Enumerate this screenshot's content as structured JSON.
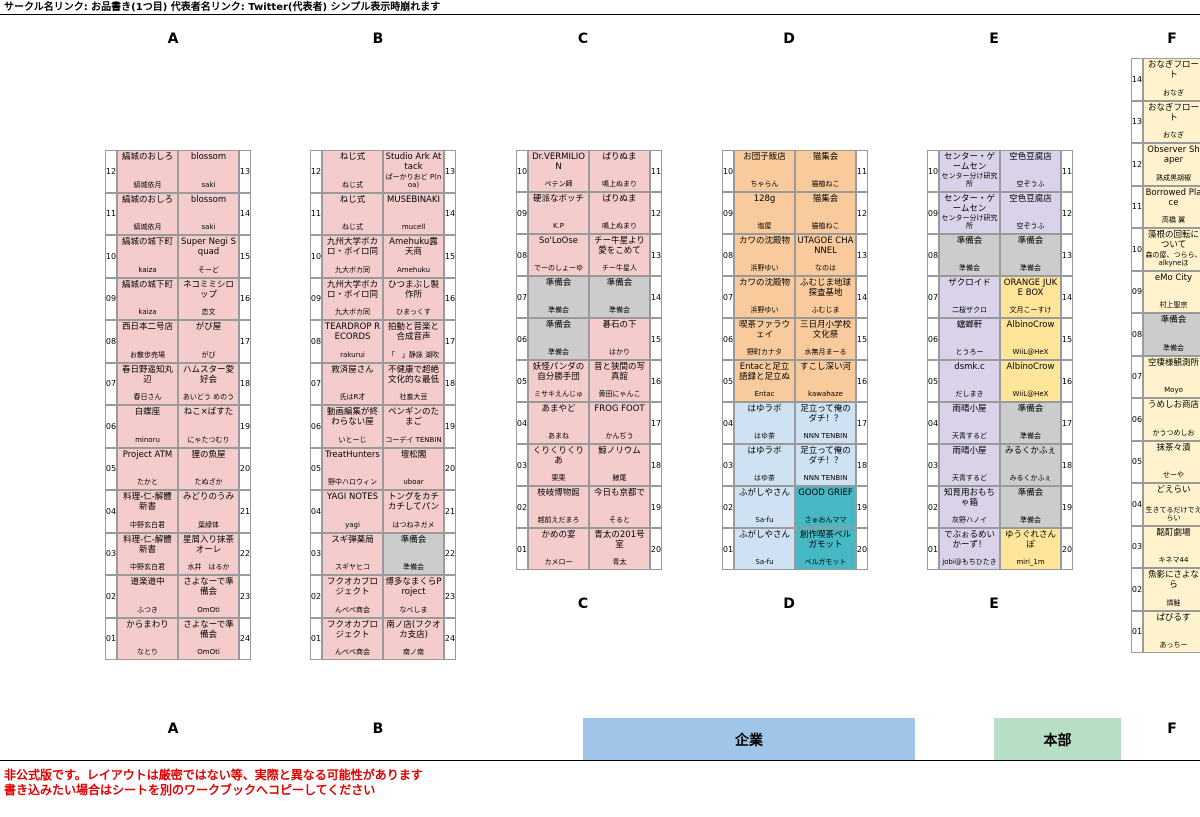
{
  "header": {
    "title": "サークル名リンク: お品書き(1つ目) 代表者名リンク: Twitter(代表者) シンプル表示時崩れます"
  },
  "columns_top": [
    "A",
    "B",
    "C",
    "D",
    "E",
    "F"
  ],
  "columns_bottom": [
    "A",
    "B",
    "C",
    "D",
    "E",
    "F"
  ],
  "zones": {
    "company": "企業",
    "hq": "本部"
  },
  "disclaimer": {
    "line1": "非公式版です。レイアウトは厳密ではない等、実際と異なる可能性があります",
    "line2": "書き込みたい場合はシートを別のワークブックへコピーしてください"
  },
  "colors": {
    "pink": "#f4cccc",
    "gray": "#cccccc",
    "orange": "#f9cb9c",
    "blue": "#cfe2f3",
    "teal": "#45b8c4",
    "purple": "#d9d2e9",
    "yellow": "#ffe599",
    "cream": "#fff2cc",
    "company": "#9fc5e8",
    "hq": "#b6dfc6"
  },
  "blocks": [
    {
      "id": "A",
      "left": [
        {
          "num": "12",
          "name": "縞城のおしろ",
          "rep": "縞城依月",
          "color": "pink"
        },
        {
          "num": "11",
          "name": "縞城のおしろ",
          "rep": "縞城依月",
          "color": "pink"
        },
        {
          "num": "10",
          "name": "縞城の城下町",
          "rep": "kaiza",
          "color": "pink"
        },
        {
          "num": "09",
          "name": "縞城の城下町",
          "rep": "kaiza",
          "color": "pink"
        },
        {
          "num": "08",
          "name": "西日本二号店",
          "rep": "お散歩売場",
          "color": "pink"
        },
        {
          "num": "07",
          "name": "春日野遥知丸辺",
          "rep": "春日さん",
          "color": "pink"
        },
        {
          "num": "06",
          "name": "白蝶座",
          "rep": "minoru",
          "color": "pink"
        },
        {
          "num": "05",
          "name": "Project ATM",
          "rep": "たかと",
          "color": "pink"
        },
        {
          "num": "04",
          "name": "料理-仁-解體新書",
          "rep": "中野玄白君",
          "color": "pink"
        },
        {
          "num": "03",
          "name": "料理-仁-解體新書",
          "rep": "中野玄白君",
          "color": "pink"
        },
        {
          "num": "02",
          "name": "道楽道中",
          "rep": "ふつき",
          "color": "pink"
        },
        {
          "num": "01",
          "name": "からまわり",
          "rep": "なとり",
          "color": "pink"
        }
      ],
      "right": [
        {
          "num": "13",
          "name": "blossom",
          "rep": "saki",
          "color": "pink"
        },
        {
          "num": "14",
          "name": "blossom",
          "rep": "saki",
          "color": "pink"
        },
        {
          "num": "15",
          "name": "Super Negi Squad",
          "rep": "そーど",
          "color": "pink"
        },
        {
          "num": "16",
          "name": "ネコミミシロップ",
          "rep": "恋文",
          "color": "pink"
        },
        {
          "num": "17",
          "name": "がび屋",
          "rep": "がび",
          "color": "pink"
        },
        {
          "num": "18",
          "name": "ハムスター愛好会",
          "rep": "あいどう めのう",
          "color": "pink"
        },
        {
          "num": "19",
          "name": "ねこ×ばすた",
          "rep": "にゃたつむり",
          "color": "pink"
        },
        {
          "num": "20",
          "name": "狸の魚屋",
          "rep": "たぬざか",
          "color": "pink"
        },
        {
          "num": "21",
          "name": "みどりのうみ",
          "rep": "葉緑体",
          "color": "pink"
        },
        {
          "num": "22",
          "name": "星屑入り抹茶オーレ",
          "rep": "水井　はるか",
          "color": "pink"
        },
        {
          "num": "23",
          "name": "さよなーで準備会",
          "rep": "OmOti",
          "color": "pink"
        },
        {
          "num": "24",
          "name": "さよなーで準備会",
          "rep": "OmOti",
          "color": "pink"
        }
      ]
    },
    {
      "id": "B",
      "left": [
        {
          "num": "12",
          "name": "ねじ式",
          "rep": "ねじ式",
          "color": "pink"
        },
        {
          "num": "11",
          "name": "ねじ式",
          "rep": "ねじ式",
          "color": "pink"
        },
        {
          "num": "10",
          "name": "九州大学ボカロ・ボイロ同",
          "rep": "九大ボカ同",
          "color": "pink"
        },
        {
          "num": "09",
          "name": "九州大学ボカロ・ボイロ同",
          "rep": "九大ボカ同",
          "color": "pink"
        },
        {
          "num": "08",
          "name": "TEARDROP RECORDS",
          "rep": "rakurui",
          "color": "pink"
        },
        {
          "num": "07",
          "name": "救済屋さん",
          "rep": "氏はR才",
          "color": "pink"
        },
        {
          "num": "06",
          "name": "動画編集が終わらない屋",
          "rep": "いとーじ",
          "color": "pink"
        },
        {
          "num": "05",
          "name": "TreatHunters",
          "rep": "野中ハロウィン",
          "color": "pink"
        },
        {
          "num": "04",
          "name": "YAGI NOTES",
          "rep": "yagi",
          "color": "pink"
        },
        {
          "num": "03",
          "name": "スギ弾薬局",
          "rep": "スギヤヒコ",
          "color": "pink"
        },
        {
          "num": "02",
          "name": "フクオカプロジェクト",
          "rep": "んぺぺ商会",
          "color": "pink"
        },
        {
          "num": "01",
          "name": "フクオカプロジェクト",
          "rep": "んぺぺ商会",
          "color": "pink"
        }
      ],
      "right": [
        {
          "num": "13",
          "name": "Studio Ark Attack",
          "rep": "ぱーかりおど P(noa)",
          "color": "pink"
        },
        {
          "num": "14",
          "name": "MUSEBINAKI",
          "rep": "mucell",
          "color": "pink"
        },
        {
          "num": "15",
          "name": "Amehuku露天商",
          "rep": "Amehuku",
          "color": "pink"
        },
        {
          "num": "16",
          "name": "ひつまぶし製作所",
          "rep": "ひまっくす",
          "color": "pink"
        },
        {
          "num": "17",
          "name": "拍動と音楽と合成音声",
          "rep": "「　」静詠 湖吹",
          "color": "pink"
        },
        {
          "num": "18",
          "name": "不健康で超絶文化的な最低",
          "rep": "社畜大豆",
          "color": "pink"
        },
        {
          "num": "19",
          "name": "ペンギンのたまご",
          "rep": "コーデイ TENBIN",
          "color": "pink"
        },
        {
          "num": "20",
          "name": "壇松閣",
          "rep": "uboar",
          "color": "pink"
        },
        {
          "num": "21",
          "name": "トングをカチカチしてパン",
          "rep": "はつねネガメ",
          "color": "pink"
        },
        {
          "num": "22",
          "name": "準備会",
          "rep": "準備会",
          "color": "gray"
        },
        {
          "num": "23",
          "name": "博多なまくらProject",
          "rep": "なべしま",
          "color": "pink"
        },
        {
          "num": "24",
          "name": "南ノ店(フクオカ支店)",
          "rep": "南ノ南",
          "color": "pink"
        }
      ]
    },
    {
      "id": "C",
      "left": [
        {
          "num": "10",
          "name": "Dr.VERMILION",
          "rep": "ペテン師",
          "color": "pink"
        },
        {
          "num": "09",
          "name": "硬派なボッチ",
          "rep": "K.P",
          "color": "pink"
        },
        {
          "num": "08",
          "name": "So'LoOse",
          "rep": "でーのしょーゆ",
          "color": "pink"
        },
        {
          "num": "07",
          "name": "準備会",
          "rep": "準備会",
          "color": "gray"
        },
        {
          "num": "06",
          "name": "準備会",
          "rep": "準備会",
          "color": "gray"
        },
        {
          "num": "05",
          "name": "妖怪パンダの自分勝手団",
          "rep": "ミサキえんじゅ",
          "color": "pink"
        },
        {
          "num": "04",
          "name": "あまやど",
          "rep": "あまね",
          "color": "pink"
        },
        {
          "num": "03",
          "name": "くりくりくりあ",
          "rep": "栗栗",
          "color": "pink"
        },
        {
          "num": "02",
          "name": "枝岐博物館",
          "rep": "越前えだまろ",
          "color": "pink"
        },
        {
          "num": "01",
          "name": "かめの宴",
          "rep": "カメロー",
          "color": "pink"
        }
      ],
      "right": [
        {
          "num": "11",
          "name": "ぱりぬま",
          "rep": "鳴上ぬまり",
          "color": "pink"
        },
        {
          "num": "12",
          "name": "ぱりぬま",
          "rep": "鳴上ぬまり",
          "color": "pink"
        },
        {
          "num": "13",
          "name": "チー牛星より愛をこめて",
          "rep": "チー牛星人",
          "color": "pink"
        },
        {
          "num": "14",
          "name": "準備会",
          "rep": "準備会",
          "color": "gray"
        },
        {
          "num": "15",
          "name": "碁石の下",
          "rep": "はかり",
          "color": "pink"
        },
        {
          "num": "16",
          "name": "音と狭間の写真館",
          "rep": "黄田にゃんこ",
          "color": "pink"
        },
        {
          "num": "17",
          "name": "FROG FOOT",
          "rep": "かんぢう",
          "color": "pink"
        },
        {
          "num": "18",
          "name": "鯨ノリウム",
          "rep": "鯨尾",
          "color": "pink"
        },
        {
          "num": "19",
          "name": "今日も京都で",
          "rep": "そると",
          "color": "pink"
        },
        {
          "num": "20",
          "name": "青太の201号室",
          "rep": "青太",
          "color": "pink"
        }
      ]
    },
    {
      "id": "D",
      "left": [
        {
          "num": "10",
          "name": "お団子飯店",
          "rep": "ちゃらん",
          "color": "orange"
        },
        {
          "num": "09",
          "name": "128g",
          "rep": "塩屋",
          "color": "orange"
        },
        {
          "num": "08",
          "name": "カワの沈殿物",
          "rep": "浜野ゆい",
          "color": "orange"
        },
        {
          "num": "07",
          "name": "カワの沈殿物",
          "rep": "浜野ゆい",
          "color": "orange"
        },
        {
          "num": "06",
          "name": "喫茶ファラウェイ",
          "rep": "野町カナタ",
          "color": "orange"
        },
        {
          "num": "05",
          "name": "Entacと足立語録と足立ぬ",
          "rep": "Entac",
          "color": "orange"
        },
        {
          "num": "04",
          "name": "はゆラボ",
          "rep": "はゆ茶",
          "color": "blue"
        },
        {
          "num": "03",
          "name": "はゆラボ",
          "rep": "はゆ茶",
          "color": "blue"
        },
        {
          "num": "02",
          "name": "ふがしやさん",
          "rep": "Sa-fu",
          "color": "blue"
        },
        {
          "num": "01",
          "name": "ふがしやさん",
          "rep": "Sa-fu",
          "color": "blue"
        }
      ],
      "right": [
        {
          "num": "11",
          "name": "猫集会",
          "rep": "猫植ねこ",
          "color": "orange"
        },
        {
          "num": "12",
          "name": "猫集会",
          "rep": "猫植ねこ",
          "color": "orange"
        },
        {
          "num": "13",
          "name": "UTAGOE CHANNEL",
          "rep": "なのは",
          "color": "orange"
        },
        {
          "num": "14",
          "name": "ふむじま地球探査基地",
          "rep": "ふむじま",
          "color": "orange"
        },
        {
          "num": "15",
          "name": "三日月小学校文化祭",
          "rep": "水無月まーる",
          "color": "orange"
        },
        {
          "num": "16",
          "name": "すこし深い河",
          "rep": "kawahaze",
          "color": "orange"
        },
        {
          "num": "17",
          "name": "足立って俺のダチ！？",
          "rep": "NNN TENBIN",
          "color": "blue"
        },
        {
          "num": "18",
          "name": "足立って俺のダチ！？",
          "rep": "NNN TENBIN",
          "color": "blue"
        },
        {
          "num": "19",
          "name": "GOOD GRIEF",
          "rep": "さゅおんママ",
          "color": "teal"
        },
        {
          "num": "20",
          "name": "創作喫茶ベルガモット",
          "rep": "ベルガモット",
          "color": "teal"
        }
      ]
    },
    {
      "id": "E",
      "left": [
        {
          "num": "10",
          "name": "センター・ゲームセン",
          "rep": "センター分け研究所",
          "color": "purple"
        },
        {
          "num": "09",
          "name": "センター・ゲームセン",
          "rep": "センター分け研究所",
          "color": "purple"
        },
        {
          "num": "08",
          "name": "準備会",
          "rep": "準備会",
          "color": "gray"
        },
        {
          "num": "07",
          "name": "ザクロイド",
          "rep": "二桜ザクロ",
          "color": "purple"
        },
        {
          "num": "06",
          "name": "蟷螂軒",
          "rep": "とうろー",
          "color": "purple"
        },
        {
          "num": "05",
          "name": "dsmk.c",
          "rep": "だしまき",
          "color": "purple"
        },
        {
          "num": "04",
          "name": "雨晴小屋",
          "rep": "天青するど",
          "color": "purple"
        },
        {
          "num": "03",
          "name": "雨晴小屋",
          "rep": "天青するど",
          "color": "purple"
        },
        {
          "num": "02",
          "name": "知育用おもちゃ箱",
          "rep": "灰野ハノイ",
          "color": "purple"
        },
        {
          "num": "01",
          "name": "でぶぉるめいかーず！",
          "rep": "jobi@もちひたき",
          "color": "purple"
        }
      ],
      "right": [
        {
          "num": "11",
          "name": "空色豆腐店",
          "rep": "空ぞうふ",
          "color": "purple"
        },
        {
          "num": "12",
          "name": "空色豆腐店",
          "rep": "空ぞうふ",
          "color": "purple"
        },
        {
          "num": "13",
          "name": "準備会",
          "rep": "準備会",
          "color": "gray"
        },
        {
          "num": "14",
          "name": "ORANGE JUKE BOX",
          "rep": "文月こーすけ",
          "color": "yellow"
        },
        {
          "num": "15",
          "name": "AlbinoCrow",
          "rep": "WiiL@HeX",
          "color": "yellow"
        },
        {
          "num": "16",
          "name": "AlbinoCrow",
          "rep": "WiiL@HeX",
          "color": "yellow"
        },
        {
          "num": "17",
          "name": "準備会",
          "rep": "準備会",
          "color": "gray"
        },
        {
          "num": "18",
          "name": "みるくかふぇ",
          "rep": "みるくかふぇ",
          "color": "gray"
        },
        {
          "num": "19",
          "name": "準備会",
          "rep": "準備会",
          "color": "gray"
        },
        {
          "num": "20",
          "name": "ゆうぐれさんぽ",
          "rep": "miri_1m",
          "color": "yellow"
        }
      ]
    },
    {
      "id": "F",
      "left": [
        {
          "num": "14",
          "name": "おなぎフロート",
          "rep": "おなぎ",
          "color": "cream"
        },
        {
          "num": "13",
          "name": "おなぎフロート",
          "rep": "おなぎ",
          "color": "cream"
        },
        {
          "num": "12",
          "name": "Observer Shaper",
          "rep": "熟成黒胡椒",
          "color": "cream"
        },
        {
          "num": "11",
          "name": "Borrowed Place",
          "rep": "高橋 翼",
          "color": "cream"
        },
        {
          "num": "10",
          "name": "藻根の回転について",
          "rep": "森の屋、つらら、alkyneほ",
          "color": "cream"
        },
        {
          "num": "09",
          "name": "eMo City",
          "rep": "村上聖宗",
          "color": "cream"
        },
        {
          "num": "08",
          "name": "準備会",
          "rep": "準備会",
          "color": "gray"
        },
        {
          "num": "07",
          "name": "空棲様観測所",
          "rep": "Moyo",
          "color": "cream"
        },
        {
          "num": "06",
          "name": "うめしお商店",
          "rep": "かうつめしお",
          "color": "cream"
        },
        {
          "num": "05",
          "name": "抹茶々漬",
          "rep": "せーや",
          "color": "cream"
        },
        {
          "num": "04",
          "name": "どえらい",
          "rep": "生きてるだけでえらい",
          "color": "cream"
        },
        {
          "num": "03",
          "name": "酩酊劇場",
          "rep": "キネマ44",
          "color": "cream"
        },
        {
          "num": "02",
          "name": "魚影にさよなら",
          "rep": "燐鮭",
          "color": "cream"
        },
        {
          "num": "01",
          "name": "ぱびるす",
          "rep": "あっちー",
          "color": "cream"
        }
      ],
      "right": []
    }
  ]
}
